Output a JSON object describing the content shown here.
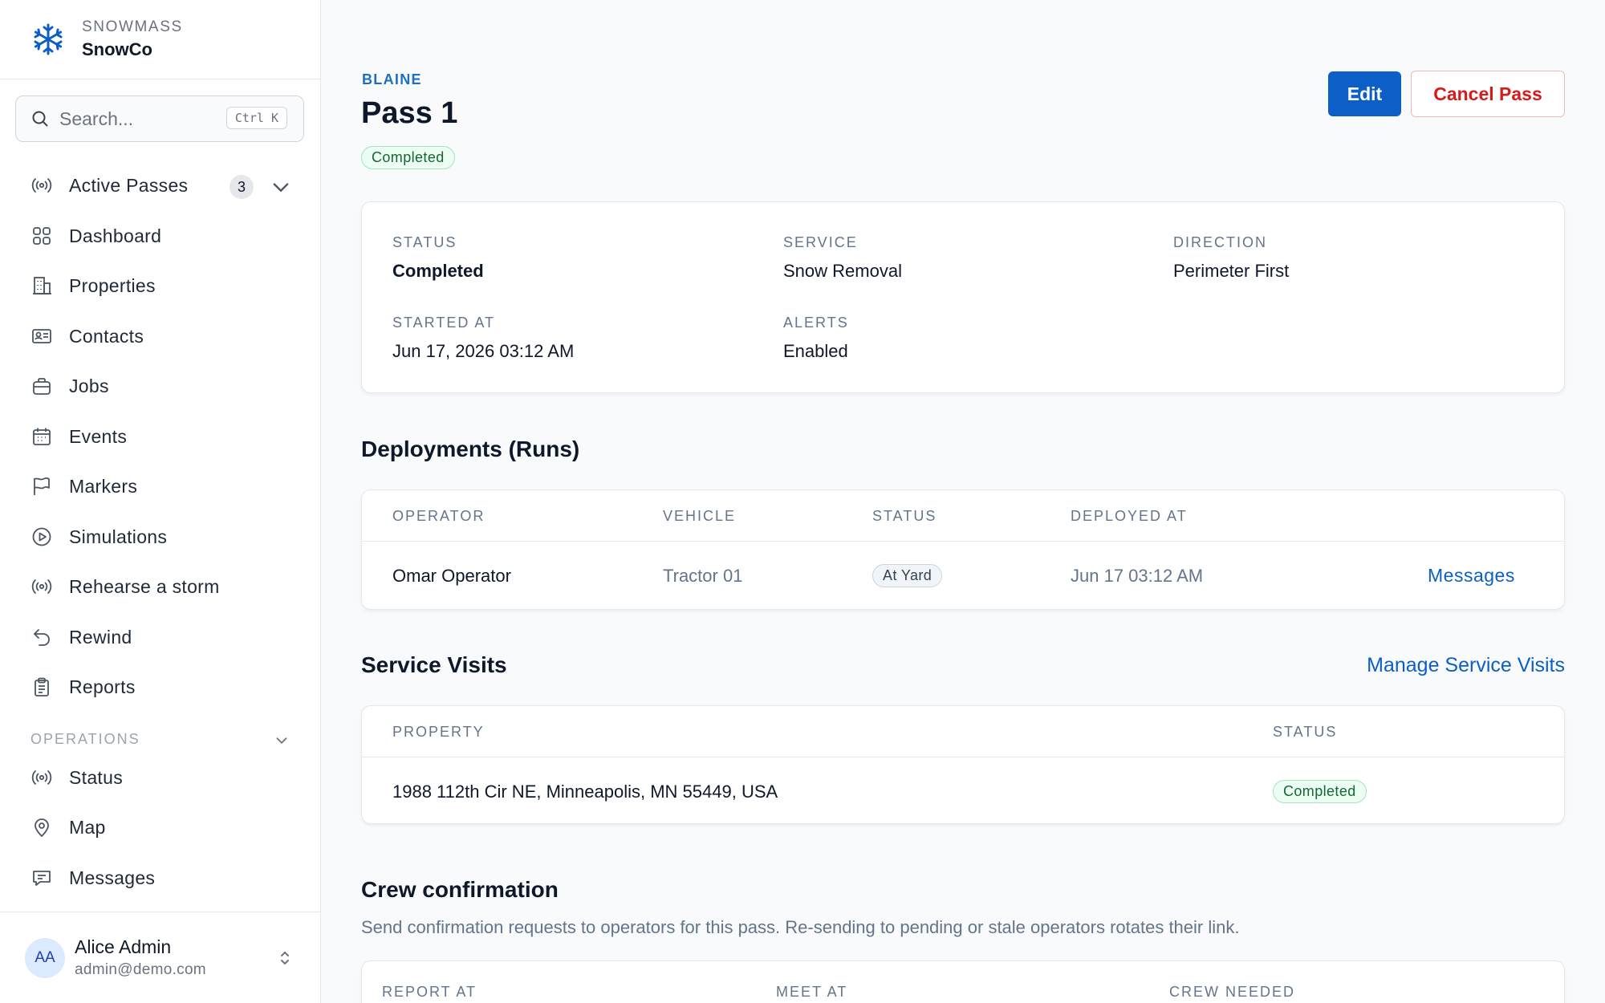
{
  "brand": {
    "org": "SNOWMASS",
    "app": "SnowCo"
  },
  "search": {
    "placeholder": "Search...",
    "shortcut": "Ctrl K"
  },
  "nav": {
    "active_passes": {
      "label": "Active Passes",
      "count": "3"
    },
    "items": [
      {
        "label": "Dashboard",
        "icon": "grid-icon"
      },
      {
        "label": "Properties",
        "icon": "building-icon"
      },
      {
        "label": "Contacts",
        "icon": "contact-card-icon"
      },
      {
        "label": "Jobs",
        "icon": "briefcase-icon"
      },
      {
        "label": "Events",
        "icon": "calendar-icon"
      },
      {
        "label": "Markers",
        "icon": "flag-icon"
      },
      {
        "label": "Simulations",
        "icon": "play-circle-icon"
      },
      {
        "label": "Rehearse a storm",
        "icon": "broadcast-icon"
      },
      {
        "label": "Rewind",
        "icon": "undo-arrow-icon"
      },
      {
        "label": "Reports",
        "icon": "clipboard-icon"
      }
    ],
    "operations_label": "OPERATIONS",
    "operations": [
      {
        "label": "Status",
        "icon": "broadcast-icon"
      },
      {
        "label": "Map",
        "icon": "map-pin-icon"
      },
      {
        "label": "Messages",
        "icon": "chat-icon"
      }
    ]
  },
  "user": {
    "initials": "AA",
    "name": "Alice Admin",
    "email": "admin@demo.com"
  },
  "pass": {
    "eyebrow": "BLAINE",
    "title": "Pass 1",
    "status_badge": "Completed",
    "edit_label": "Edit",
    "cancel_label": "Cancel Pass"
  },
  "summary": {
    "status_label": "STATUS",
    "status_value": "Completed",
    "service_label": "SERVICE",
    "service_value": "Snow Removal",
    "direction_label": "DIRECTION",
    "direction_value": "Perimeter First",
    "started_label": "STARTED AT",
    "started_value": "Jun 17, 2026 03:12 AM",
    "alerts_label": "ALERTS",
    "alerts_value": "Enabled"
  },
  "deployments": {
    "title": "Deployments (Runs)",
    "headers": [
      "OPERATOR",
      "VEHICLE",
      "STATUS",
      "DEPLOYED AT"
    ],
    "rows": [
      {
        "operator": "Omar Operator",
        "vehicle": "Tractor 01",
        "status": "At Yard",
        "deployed_at": "Jun 17 03:12 AM",
        "action": "Messages"
      }
    ]
  },
  "service_visits": {
    "title": "Service Visits",
    "manage_label": "Manage Service Visits",
    "headers": [
      "PROPERTY",
      "STATUS"
    ],
    "rows": [
      {
        "property": "1988 112th Cir NE, Minneapolis, MN 55449, USA",
        "status": "Completed"
      }
    ]
  },
  "crew": {
    "title": "Crew confirmation",
    "subtitle": "Send confirmation requests to operators for this pass. Re-sending to pending or stale operators rotates their link.",
    "headers": [
      "REPORT AT",
      "MEET AT",
      "CREW NEEDED"
    ]
  },
  "colors": {
    "accent": "#0b5fc6",
    "danger": "#d71a1a",
    "success_bg": "#ecfdf3",
    "success_text": "#166534"
  }
}
